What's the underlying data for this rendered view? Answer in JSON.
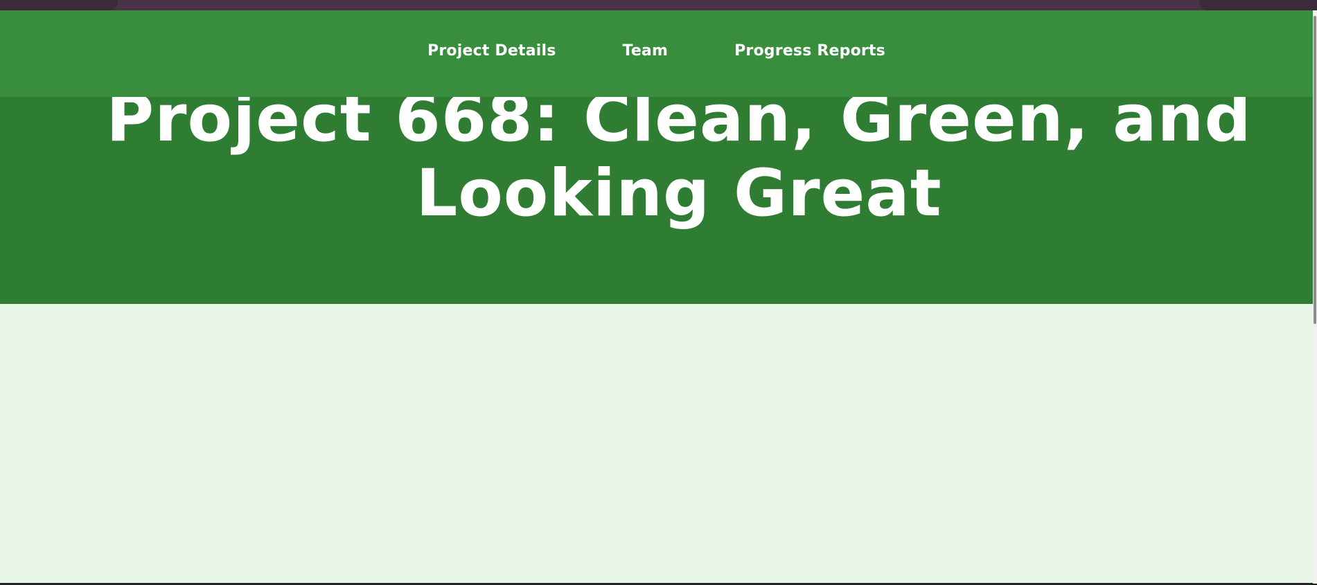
{
  "navbar": {
    "links": [
      {
        "label": "Project Details"
      },
      {
        "label": "Team"
      },
      {
        "label": "Progress Reports"
      }
    ]
  },
  "hero": {
    "title": "Project 668: Clean, Green, and Looking Great"
  },
  "colors": {
    "navbar_bg": "#388e3c",
    "hero_bg": "#2e7d32",
    "page_bg": "#e8f5e9",
    "text": "#ffffff",
    "browser_chrome": "#4a3347"
  }
}
